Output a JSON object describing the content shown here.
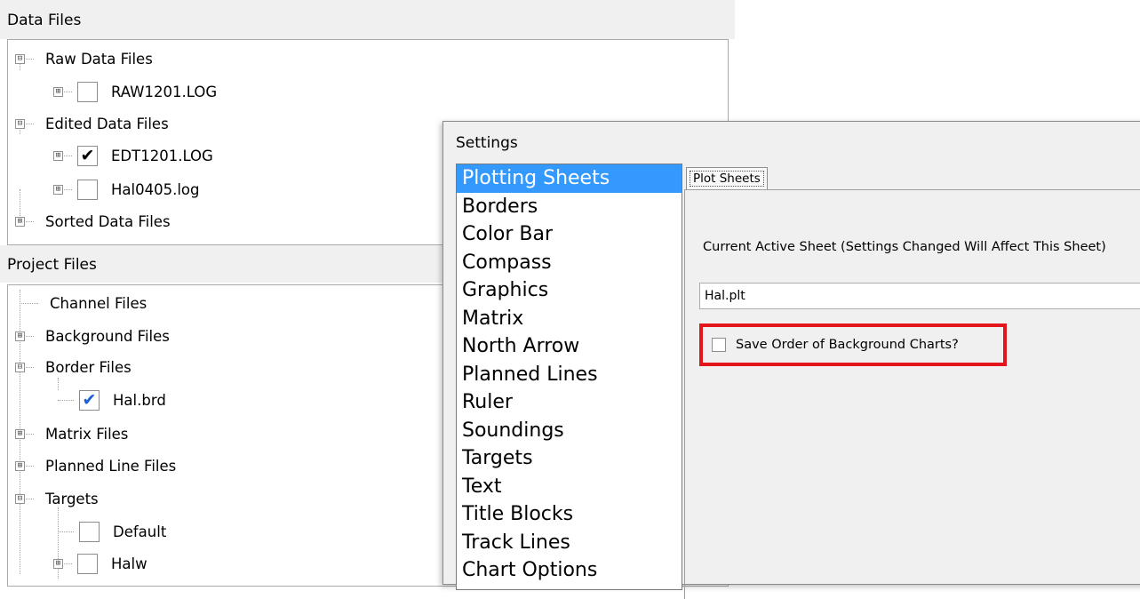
{
  "data_files": {
    "header": "Data Files",
    "nodes": [
      {
        "label": "Raw Data Files",
        "expander": "⊟"
      },
      {
        "label": "RAW1201.LOG",
        "expander": "⊞",
        "checked": ""
      },
      {
        "label": "Edited Data Files",
        "expander": "⊟"
      },
      {
        "label": "EDT1201.LOG",
        "expander": "⊞",
        "checked": "✔"
      },
      {
        "label": "Hal0405.log",
        "expander": "⊞",
        "checked": ""
      },
      {
        "label": "Sorted Data Files",
        "expander": "⊞"
      }
    ]
  },
  "project_files": {
    "header": "Project Files",
    "nodes": [
      {
        "label": "Channel Files"
      },
      {
        "label": "Background Files",
        "expander": "⊞"
      },
      {
        "label": "Border Files",
        "expander": "⊟"
      },
      {
        "label": "Hal.brd",
        "checked": "✔"
      },
      {
        "label": "Matrix Files",
        "expander": "⊞"
      },
      {
        "label": "Planned Line Files",
        "expander": "⊞"
      },
      {
        "label": "Targets",
        "expander": "⊟"
      },
      {
        "label": "Default",
        "checked": ""
      },
      {
        "label": "Halw",
        "expander": "⊞",
        "checked": ""
      }
    ]
  },
  "settings": {
    "title": "Settings",
    "categories": [
      "Plotting Sheets",
      "Borders",
      "Color Bar",
      "Compass",
      "Graphics",
      "Matrix",
      "North Arrow",
      "Planned Lines",
      "Ruler",
      "Soundings",
      "Targets",
      "Text",
      "Title Blocks",
      "Track Lines",
      "Chart Options"
    ],
    "selected_index": 0,
    "tab_label": "Plot Sheets",
    "active_sheet_label": "Current Active Sheet (Settings Changed Will Affect This Sheet)",
    "active_sheet_value": "Hal.plt",
    "save_order_label": "Save Order of Background Charts?",
    "save_order_checked": false,
    "highlight_color": "#e3151b",
    "selection_color": "#3399ff"
  }
}
